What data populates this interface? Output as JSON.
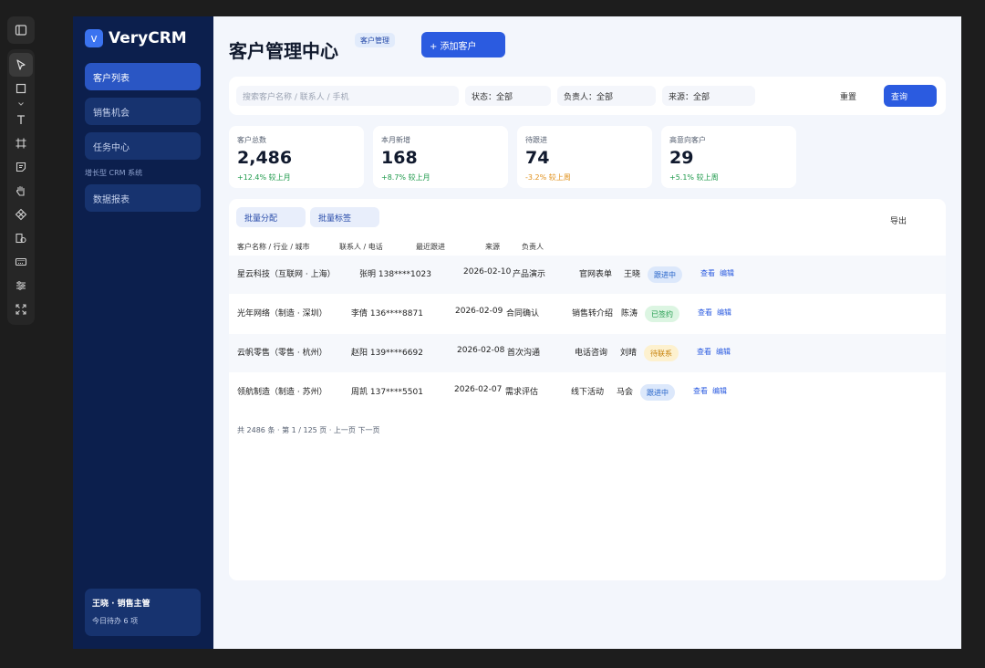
{
  "app": {
    "brand_logo": "v",
    "brand_name": "VeryCRM",
    "accent_color": "#2b5be0",
    "sidebar_bg": "#0c1f4d"
  },
  "sidebar": {
    "items": [
      {
        "label": "客户列表",
        "active": true
      },
      {
        "label": "销售机会"
      },
      {
        "label": "任务中心"
      },
      {
        "label": "数据报表"
      }
    ],
    "subtitle": "增长型 CRM 系统",
    "user": {
      "name": "王晓 · 销售主管",
      "todo": "今日待办 6 项"
    }
  },
  "header": {
    "title": "客户管理中心",
    "breadcrumb": "客户管理",
    "add_button": "+ 添加客户"
  },
  "filters": {
    "search_placeholder": "搜索客户名称 / 联系人 / 手机",
    "status": "状态：全部",
    "owner": "负责人：全部",
    "source": "来源：全部",
    "reset": "重置",
    "query": "查询"
  },
  "stats": [
    {
      "label": "客户总数",
      "value": "2,486",
      "delta": "+12.4% 较上月",
      "trend": "up"
    },
    {
      "label": "本月新增",
      "value": "168",
      "delta": "+8.7% 较上月",
      "trend": "up"
    },
    {
      "label": "待跟进",
      "value": "74",
      "delta": "-3.2% 较上周",
      "trend": "down"
    },
    {
      "label": "高意向客户",
      "value": "29",
      "delta": "+5.1% 较上周",
      "trend": "up"
    }
  ],
  "table": {
    "bulk_assign": "批量分配",
    "bulk_tag": "批量标签",
    "export": "导出",
    "headers": {
      "customer": "客户名称 / 行业 / 城市",
      "contact": "联系人 / 电话",
      "last_follow": "最近跟进",
      "source": "来源",
      "owner": "负责人"
    },
    "rows": [
      {
        "customer": "星云科技（互联网 · 上海）",
        "contact": "张明  138****1023",
        "date": "2026-02-10",
        "stage": "产品演示",
        "source": "官网表单",
        "owner": "王晓",
        "status": "跟进中",
        "status_type": "blue",
        "view": "查看",
        "edit": "编辑"
      },
      {
        "customer": "光年网络（制造 · 深圳）",
        "contact": "李倩  136****8871",
        "date": "2026-02-09",
        "stage": "合同确认",
        "source": "销售转介绍",
        "owner": "陈涛",
        "status": "已签约",
        "status_type": "green",
        "view": "查看",
        "edit": "编辑"
      },
      {
        "customer": "云帆零售（零售 · 杭州）",
        "contact": "赵阳  139****6692",
        "date": "2026-02-08",
        "stage": "首次沟通",
        "source": "电话咨询",
        "owner": "刘晴",
        "status": "待联系",
        "status_type": "amber",
        "view": "查看",
        "edit": "编辑"
      },
      {
        "customer": "领航制造（制造 · 苏州）",
        "contact": "周凯  137****5501",
        "date": "2026-02-07",
        "stage": "需求评估",
        "source": "线下活动",
        "owner": "马会",
        "status": "跟进中",
        "status_type": "blue",
        "view": "查看",
        "edit": "编辑"
      }
    ],
    "pagination": "共 2486 条 · 第 1 / 125 页 · 上一页  下一页"
  },
  "colors": {
    "up": "#1e9a4b",
    "down": "#e0901a"
  }
}
